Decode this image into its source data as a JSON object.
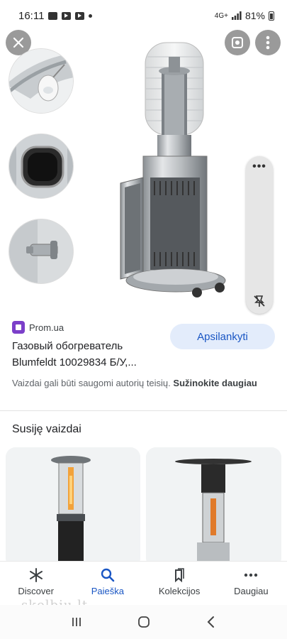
{
  "status_bar": {
    "time": "16:11",
    "signal": "4G+",
    "battery": "81%"
  },
  "viewer": {
    "close_icon": "close-icon",
    "lens_icon": "lens-icon",
    "more_icon": "more-vert-icon",
    "side_panel_dots": "•••",
    "side_panel_icon": "pin-off-icon"
  },
  "source": {
    "name": "Prom.ua",
    "title": "Газовый обогреватель Blumfeldt 10029834 Б/У,...",
    "visit_label": "Apsilankyti",
    "copyright_text": "Vaizdai gali būti saugomi autorių teisių.",
    "learn_more": "Sužinokite daugiau"
  },
  "related": {
    "title": "Susiję vaizdai"
  },
  "bottom_nav": {
    "items": [
      {
        "label": "Discover",
        "icon": "asterisk-icon"
      },
      {
        "label": "Paieška",
        "icon": "search-icon"
      },
      {
        "label": "Kolekcijos",
        "icon": "bookmark-icon"
      },
      {
        "label": "Daugiau",
        "icon": "more-horiz-icon"
      }
    ],
    "active": "Paieška"
  },
  "watermark": "skelbiu.lt",
  "colors": {
    "accent": "#1a56c4",
    "visit_button_bg": "#e3ecfb",
    "favicon": "#7b3fc9"
  }
}
